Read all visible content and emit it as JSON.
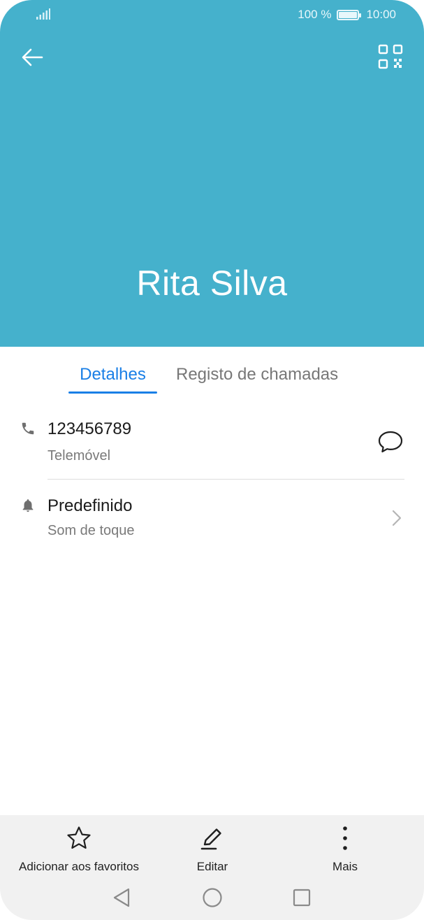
{
  "status_bar": {
    "battery_percent": "100 %",
    "time": "10:00"
  },
  "header": {
    "background_color": "#45b1cc",
    "back_icon": "arrow-left-icon",
    "qr_icon": "qr-code-icon"
  },
  "contact": {
    "name": "Rita Silva"
  },
  "tabs": [
    {
      "label": "Detalhes",
      "active": true
    },
    {
      "label": "Registo de chamadas",
      "active": false
    }
  ],
  "accent_color": "#1a7fe6",
  "phone_entry": {
    "number": "123456789",
    "type": "Telemóvel",
    "icon": "phone-icon",
    "action_icon": "message-bubble-icon"
  },
  "ringtone_entry": {
    "value": "Predefinido",
    "label": "Som de toque",
    "icon": "bell-icon"
  },
  "action_bar": {
    "favorite_label": "Adicionar aos favoritos",
    "edit_label": "Editar",
    "more_label": "Mais"
  }
}
